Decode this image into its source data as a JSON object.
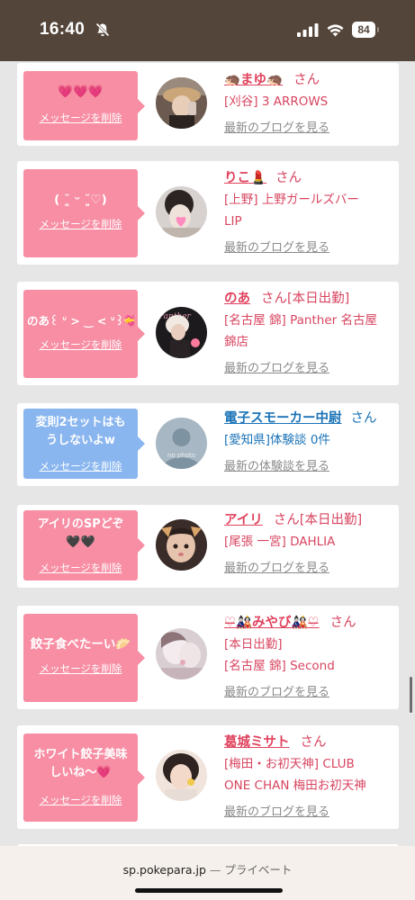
{
  "status_bar": {
    "time": "16:40",
    "battery": "84"
  },
  "bubble_delete_label": "メッセージを削除",
  "san_label": "さん",
  "cards": [
    {
      "message": "💗💗💗",
      "name": "🦔まゆ🦔",
      "suffix": "",
      "shop_lines": [
        "[刈谷] 3 ARROWS"
      ],
      "blog_link": "最新のブログを見る"
    },
    {
      "message": "( ˘͈ ᵕ ˘͈♡)",
      "name": "りこ💄",
      "suffix": "",
      "shop_lines": [
        "[上野] 上野ガールズバー",
        "LIP"
      ],
      "blog_link": "最新のブログを見る"
    },
    {
      "message": "のあ꒰ ᐡ > ‿ < ᐡ꒱💝",
      "name": "のあ",
      "suffix": "[本日出勤]",
      "shop_lines": [
        "[名古屋 錦] Panther 名古屋",
        "錦店"
      ],
      "blog_link": "最新のブログを見る"
    },
    {
      "message_lines": [
        "変則2セットはも",
        "うしないよw"
      ],
      "name": "電子スモーカー中尉",
      "suffix": "",
      "shop_lines": [
        "[愛知県]体験談 0件"
      ],
      "blog_link": "最新の体験談を見る",
      "avatar_text": "no photo"
    },
    {
      "message_lines": [
        "アイリのSPどぞ",
        "🖤🖤"
      ],
      "name": "アイリ",
      "suffix": "[本日出勤]",
      "shop_lines": [
        "[尾張 一宮] DAHLIA"
      ],
      "blog_link": "最新のブログを見る"
    },
    {
      "message": "餃子食べたーい🥟",
      "name": "♡̶🎎みやび🎎♡̶",
      "suffix": "",
      "shop_lines": [
        "[本日出勤]",
        "[名古屋 錦] Second"
      ],
      "blog_link": "最新のブログを見る"
    },
    {
      "message_lines": [
        "ホワイト餃子美味",
        "しいね〜💗"
      ],
      "name": "葛城ミサト",
      "suffix": "",
      "shop_lines": [
        "[梅田・お初天神] CLUB",
        "ONE CHAN 梅田お初天神"
      ],
      "blog_link": "最新のブログを見る"
    }
  ],
  "browser": {
    "url": "sp.pokepara.jp",
    "separator": "—",
    "mode": "プライベート"
  }
}
